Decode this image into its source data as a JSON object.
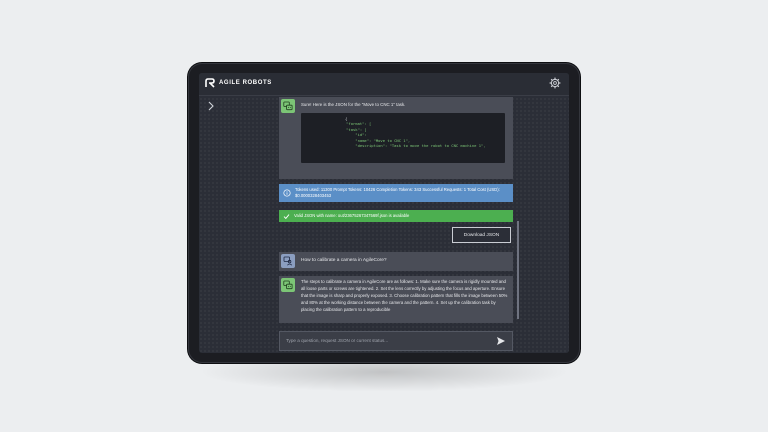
{
  "brand": {
    "name": "AGILE ROBOTS"
  },
  "icons": {
    "logo": "agile-robots-logo",
    "settings": "gear-icon",
    "expand": "chevron-right-icon",
    "ai_avatar": "robot-chat-icon",
    "user_avatar": "user-question-icon",
    "info": "info-circle-icon",
    "check": "check-icon",
    "send": "send-icon"
  },
  "colors": {
    "screen_bg": "#2b2e37",
    "ai_bubble": "#4a4d57",
    "user_bubble": "#4a4d57",
    "ai_avatar": "#7cc576",
    "user_avatar": "#8b9ec0",
    "info_banner": "#5b8fc7",
    "success_banner": "#4caf50",
    "code_string": "#7cc576"
  },
  "chat": {
    "messages": [
      {
        "role": "assistant",
        "text": "Sure! Here is the JSON for the \"Move to CNC 1\" task.",
        "code_lines": [
          "{",
          "    \"format\": [",
          "    \"task\": [",
          "        \"id\": ",
          "        \"name\": \"Move to CNC 1\",",
          "        \"description\": \"Task to move the robot to CNC machine 1\","
        ]
      },
      {
        "role": "system-info",
        "text": "Tokens used: 11300 Prompt Tokens: 10426 Completion Tokens: 343 Successful Requests: 1 Total Cost (USD): $0.0000328403453"
      },
      {
        "role": "system-success",
        "text": "Valid JSON with name: out/23675267347569f.json is available"
      },
      {
        "role": "user",
        "text": "How to calibrate a camera in AgileCore?"
      },
      {
        "role": "assistant",
        "text": "The steps to calibrate a camera in AgileCore are as follows: 1. Make sure the camera is rigidly mounted and all loose parts or screws are tightened. 2. Set the lens correctly by adjusting the focus and aperture. Ensure that the image is sharp and properly exposed. 3. Choose calibration pattern that fills the image between 50% and 80% at the working distance between the camera and the pattern. 4. Set up the calibration task by placing the calibration pattern to a reproducible"
      }
    ],
    "download_label": "Download JSON"
  },
  "input": {
    "placeholder": "Type a question, request JSON or current status..."
  }
}
